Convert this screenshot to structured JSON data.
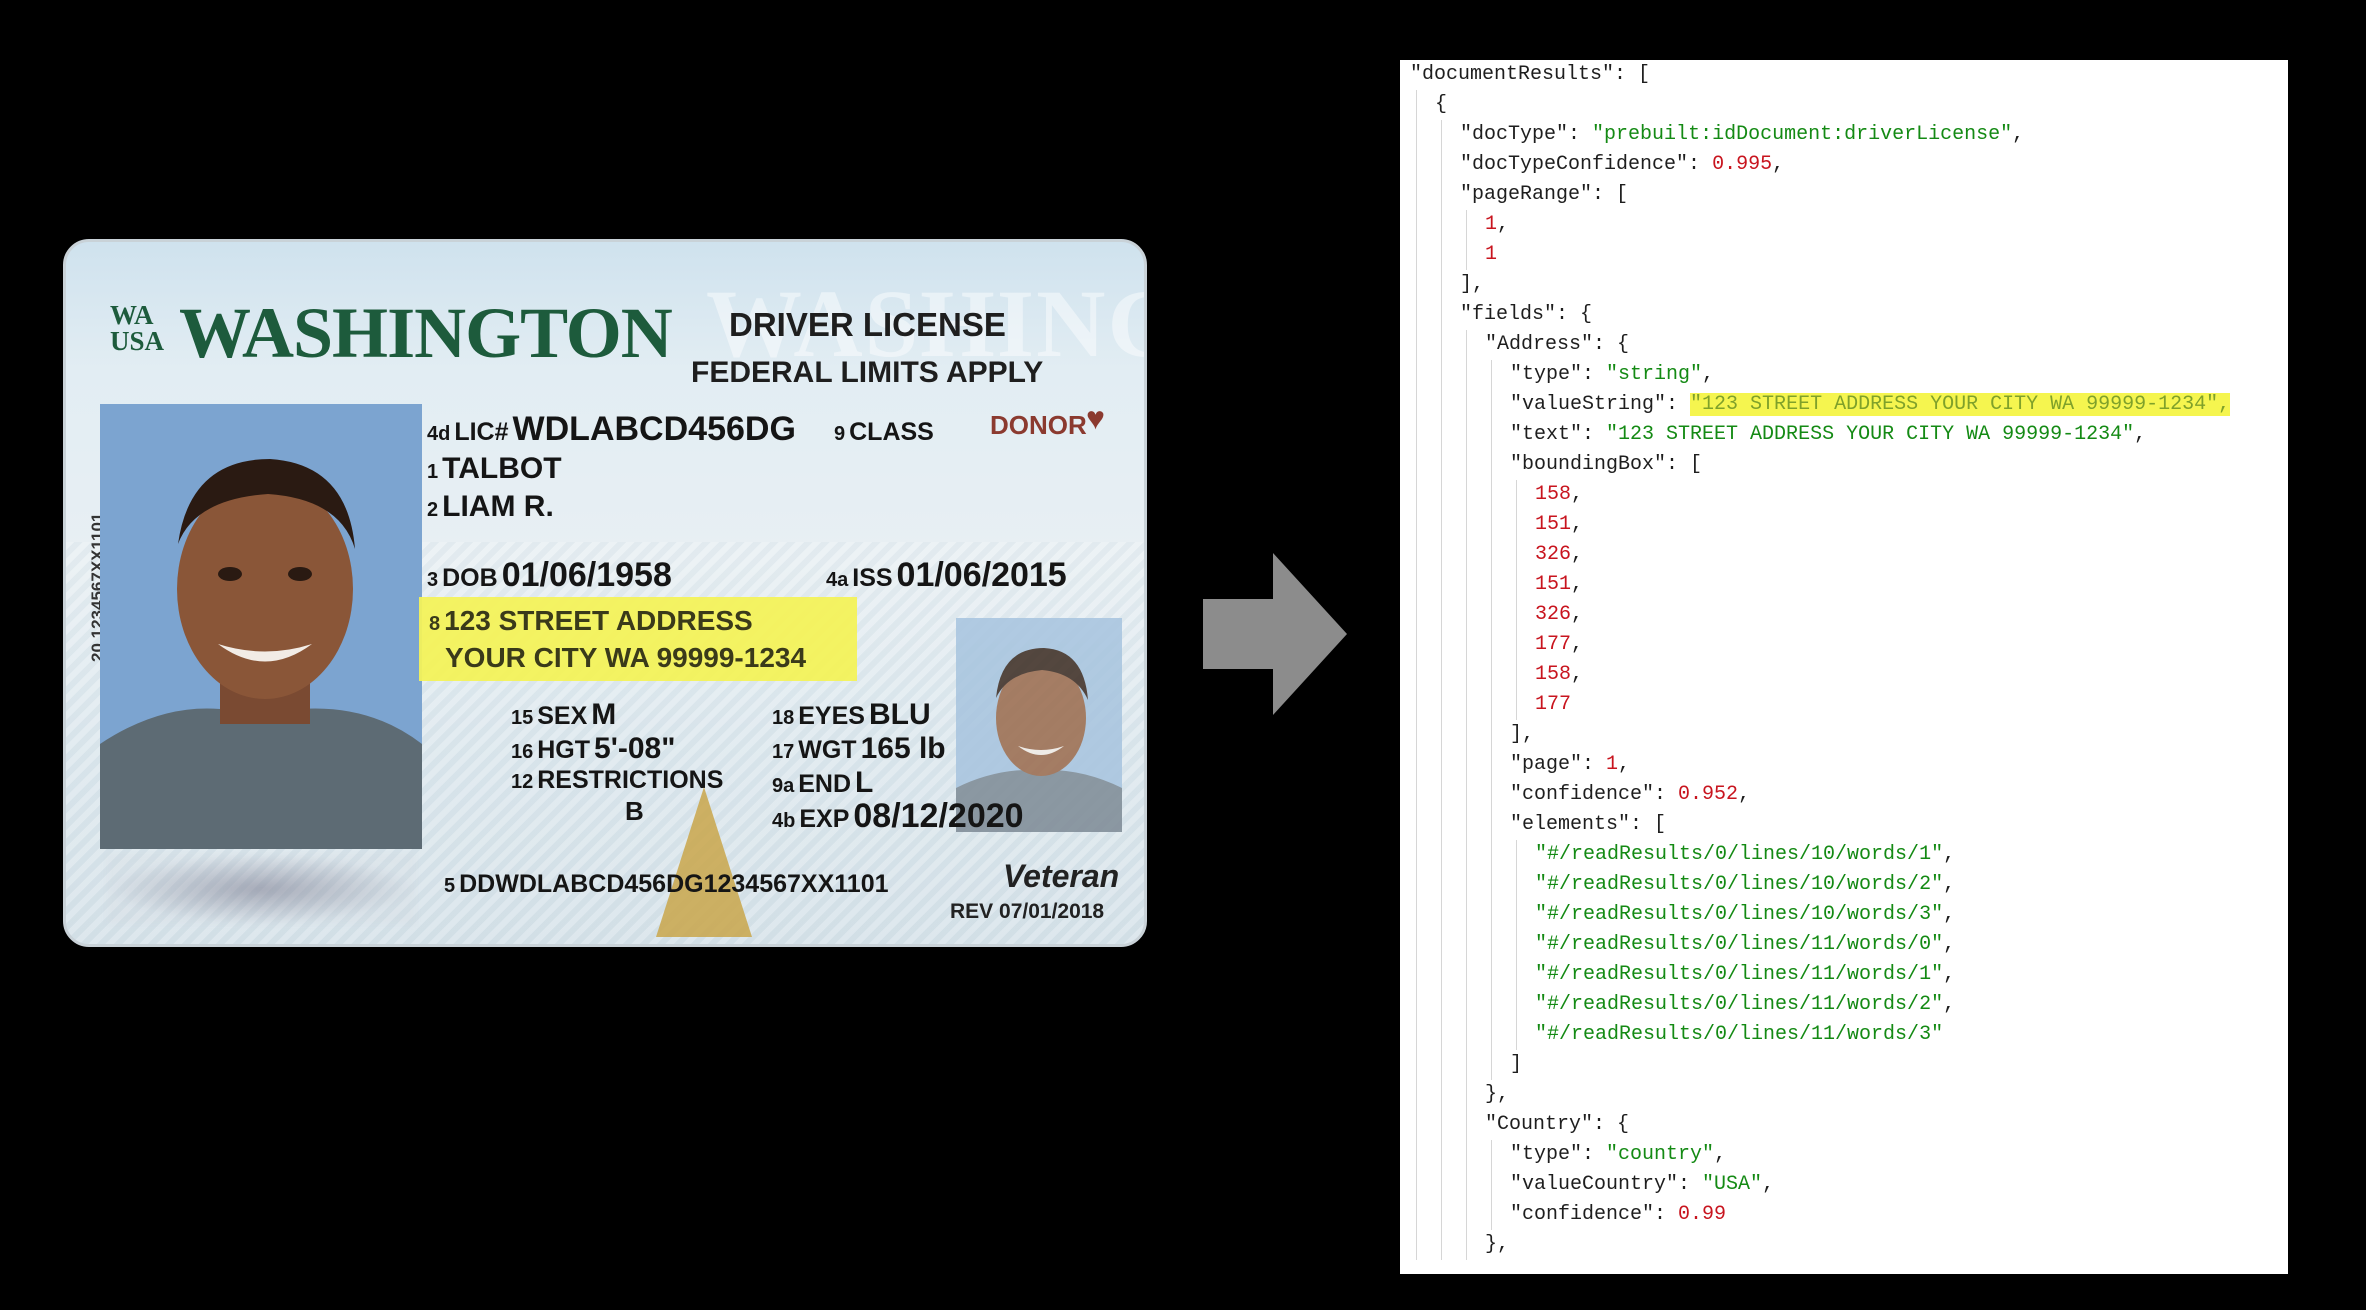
{
  "card": {
    "state_code_top": "WA",
    "state_code_bottom": "USA",
    "state_name": "WASHINGTON",
    "watermark": "WASHINGTON",
    "doc_title": "DRIVER LICENSE",
    "federal_limits": "FEDERAL LIMITS APPLY",
    "vertical_code": "20   1234567XX1101",
    "lic": {
      "num": "4d",
      "label": "LIC#",
      "value": "WDLABCD456DG"
    },
    "class": {
      "num": "9",
      "label": "CLASS"
    },
    "donor": "DONOR",
    "last_name": {
      "num": "1",
      "value": "TALBOT"
    },
    "first_name": {
      "num": "2",
      "value": "LIAM R."
    },
    "dob": {
      "num": "3",
      "label": "DOB",
      "value": "01/06/1958"
    },
    "iss": {
      "num": "4a",
      "label": "ISS",
      "value": "01/06/2015"
    },
    "address": {
      "num": "8",
      "line1": "123 STREET ADDRESS",
      "line2": "YOUR CITY WA 99999-1234"
    },
    "sex": {
      "num": "15",
      "label": "SEX",
      "value": "M"
    },
    "hgt": {
      "num": "16",
      "label": "HGT",
      "value": "5'-08\""
    },
    "eyes": {
      "num": "18",
      "label": "EYES",
      "value": "BLU"
    },
    "wgt": {
      "num": "17",
      "label": "WGT",
      "value": "165 lb"
    },
    "restrictions": {
      "num": "12",
      "label": "RESTRICTIONS",
      "value": "B"
    },
    "end": {
      "num": "9a",
      "label": "END",
      "value": "L"
    },
    "exp": {
      "num": "4b",
      "label": "EXP",
      "value": "08/12/2020"
    },
    "dd": {
      "num": "5",
      "value": "DDWDLABCD456DG1234567XX1101"
    },
    "veteran": "Veteran",
    "rev": "REV 07/01/2018"
  },
  "colors": {
    "state_green": "#1d5b3c",
    "donor": "#8b3a2f",
    "highlight": "#f3f25a",
    "json_string": "#148a14",
    "json_number": "#c8141e",
    "arrow": "#8c8c8c"
  },
  "json_lines": [
    {
      "indent": 0,
      "tokens": [
        {
          "t": "k",
          "v": "\"documentResults\""
        },
        {
          "t": "p",
          "v": ": ["
        }
      ]
    },
    {
      "indent": 1,
      "tokens": [
        {
          "t": "p",
          "v": "{"
        }
      ]
    },
    {
      "indent": 2,
      "tokens": [
        {
          "t": "k",
          "v": "\"docType\""
        },
        {
          "t": "p",
          "v": ": "
        },
        {
          "t": "s",
          "v": "\"prebuilt:idDocument:driverLicense\""
        },
        {
          "t": "p",
          "v": ","
        }
      ]
    },
    {
      "indent": 2,
      "tokens": [
        {
          "t": "k",
          "v": "\"docTypeConfidence\""
        },
        {
          "t": "p",
          "v": ": "
        },
        {
          "t": "num",
          "v": "0.995"
        },
        {
          "t": "p",
          "v": ","
        }
      ]
    },
    {
      "indent": 2,
      "tokens": [
        {
          "t": "k",
          "v": "\"pageRange\""
        },
        {
          "t": "p",
          "v": ": ["
        }
      ]
    },
    {
      "indent": 3,
      "tokens": [
        {
          "t": "num",
          "v": "1"
        },
        {
          "t": "p",
          "v": ","
        }
      ]
    },
    {
      "indent": 3,
      "tokens": [
        {
          "t": "num",
          "v": "1"
        }
      ]
    },
    {
      "indent": 2,
      "tokens": [
        {
          "t": "p",
          "v": "],"
        }
      ]
    },
    {
      "indent": 2,
      "tokens": [
        {
          "t": "k",
          "v": "\"fields\""
        },
        {
          "t": "p",
          "v": ": {"
        }
      ]
    },
    {
      "indent": 3,
      "tokens": [
        {
          "t": "k",
          "v": "\"Address\""
        },
        {
          "t": "p",
          "v": ": {"
        }
      ]
    },
    {
      "indent": 4,
      "tokens": [
        {
          "t": "k",
          "v": "\"type\""
        },
        {
          "t": "p",
          "v": ": "
        },
        {
          "t": "s",
          "v": "\"string\""
        },
        {
          "t": "p",
          "v": ","
        }
      ]
    },
    {
      "indent": 4,
      "tokens": [
        {
          "t": "k",
          "v": "\"valueString\""
        },
        {
          "t": "p",
          "v": ": "
        },
        {
          "t": "hl",
          "v": "\"123 STREET ADDRESS YOUR CITY WA 99999-1234\","
        }
      ]
    },
    {
      "indent": 4,
      "tokens": [
        {
          "t": "k",
          "v": "\"text\""
        },
        {
          "t": "p",
          "v": ": "
        },
        {
          "t": "s",
          "v": "\"123 STREET ADDRESS YOUR CITY WA 99999-1234\""
        },
        {
          "t": "p",
          "v": ","
        }
      ]
    },
    {
      "indent": 4,
      "tokens": [
        {
          "t": "k",
          "v": "\"boundingBox\""
        },
        {
          "t": "p",
          "v": ": ["
        }
      ]
    },
    {
      "indent": 5,
      "tokens": [
        {
          "t": "num",
          "v": "158"
        },
        {
          "t": "p",
          "v": ","
        }
      ]
    },
    {
      "indent": 5,
      "tokens": [
        {
          "t": "num",
          "v": "151"
        },
        {
          "t": "p",
          "v": ","
        }
      ]
    },
    {
      "indent": 5,
      "tokens": [
        {
          "t": "num",
          "v": "326"
        },
        {
          "t": "p",
          "v": ","
        }
      ]
    },
    {
      "indent": 5,
      "tokens": [
        {
          "t": "num",
          "v": "151"
        },
        {
          "t": "p",
          "v": ","
        }
      ]
    },
    {
      "indent": 5,
      "tokens": [
        {
          "t": "num",
          "v": "326"
        },
        {
          "t": "p",
          "v": ","
        }
      ]
    },
    {
      "indent": 5,
      "tokens": [
        {
          "t": "num",
          "v": "177"
        },
        {
          "t": "p",
          "v": ","
        }
      ]
    },
    {
      "indent": 5,
      "tokens": [
        {
          "t": "num",
          "v": "158"
        },
        {
          "t": "p",
          "v": ","
        }
      ]
    },
    {
      "indent": 5,
      "tokens": [
        {
          "t": "num",
          "v": "177"
        }
      ]
    },
    {
      "indent": 4,
      "tokens": [
        {
          "t": "p",
          "v": "],"
        }
      ]
    },
    {
      "indent": 4,
      "tokens": [
        {
          "t": "k",
          "v": "\"page\""
        },
        {
          "t": "p",
          "v": ": "
        },
        {
          "t": "num",
          "v": "1"
        },
        {
          "t": "p",
          "v": ","
        }
      ]
    },
    {
      "indent": 4,
      "tokens": [
        {
          "t": "k",
          "v": "\"confidence\""
        },
        {
          "t": "p",
          "v": ": "
        },
        {
          "t": "num",
          "v": "0.952"
        },
        {
          "t": "p",
          "v": ","
        }
      ]
    },
    {
      "indent": 4,
      "tokens": [
        {
          "t": "k",
          "v": "\"elements\""
        },
        {
          "t": "p",
          "v": ": ["
        }
      ]
    },
    {
      "indent": 5,
      "tokens": [
        {
          "t": "s",
          "v": "\"#/readResults/0/lines/10/words/1\""
        },
        {
          "t": "p",
          "v": ","
        }
      ]
    },
    {
      "indent": 5,
      "tokens": [
        {
          "t": "s",
          "v": "\"#/readResults/0/lines/10/words/2\""
        },
        {
          "t": "p",
          "v": ","
        }
      ]
    },
    {
      "indent": 5,
      "tokens": [
        {
          "t": "s",
          "v": "\"#/readResults/0/lines/10/words/3\""
        },
        {
          "t": "p",
          "v": ","
        }
      ]
    },
    {
      "indent": 5,
      "tokens": [
        {
          "t": "s",
          "v": "\"#/readResults/0/lines/11/words/0\""
        },
        {
          "t": "p",
          "v": ","
        }
      ]
    },
    {
      "indent": 5,
      "tokens": [
        {
          "t": "s",
          "v": "\"#/readResults/0/lines/11/words/1\""
        },
        {
          "t": "p",
          "v": ","
        }
      ]
    },
    {
      "indent": 5,
      "tokens": [
        {
          "t": "s",
          "v": "\"#/readResults/0/lines/11/words/2\""
        },
        {
          "t": "p",
          "v": ","
        }
      ]
    },
    {
      "indent": 5,
      "tokens": [
        {
          "t": "s",
          "v": "\"#/readResults/0/lines/11/words/3\""
        }
      ]
    },
    {
      "indent": 4,
      "tokens": [
        {
          "t": "p",
          "v": "]"
        }
      ]
    },
    {
      "indent": 3,
      "tokens": [
        {
          "t": "p",
          "v": "},"
        }
      ]
    },
    {
      "indent": 3,
      "tokens": [
        {
          "t": "k",
          "v": "\"Country\""
        },
        {
          "t": "p",
          "v": ": {"
        }
      ]
    },
    {
      "indent": 4,
      "tokens": [
        {
          "t": "k",
          "v": "\"type\""
        },
        {
          "t": "p",
          "v": ": "
        },
        {
          "t": "s",
          "v": "\"country\""
        },
        {
          "t": "p",
          "v": ","
        }
      ]
    },
    {
      "indent": 4,
      "tokens": [
        {
          "t": "k",
          "v": "\"valueCountry\""
        },
        {
          "t": "p",
          "v": ": "
        },
        {
          "t": "s",
          "v": "\"USA\""
        },
        {
          "t": "p",
          "v": ","
        }
      ]
    },
    {
      "indent": 4,
      "tokens": [
        {
          "t": "k",
          "v": "\"confidence\""
        },
        {
          "t": "p",
          "v": ": "
        },
        {
          "t": "num",
          "v": "0.99"
        }
      ]
    },
    {
      "indent": 3,
      "tokens": [
        {
          "t": "p",
          "v": "},"
        }
      ]
    }
  ]
}
